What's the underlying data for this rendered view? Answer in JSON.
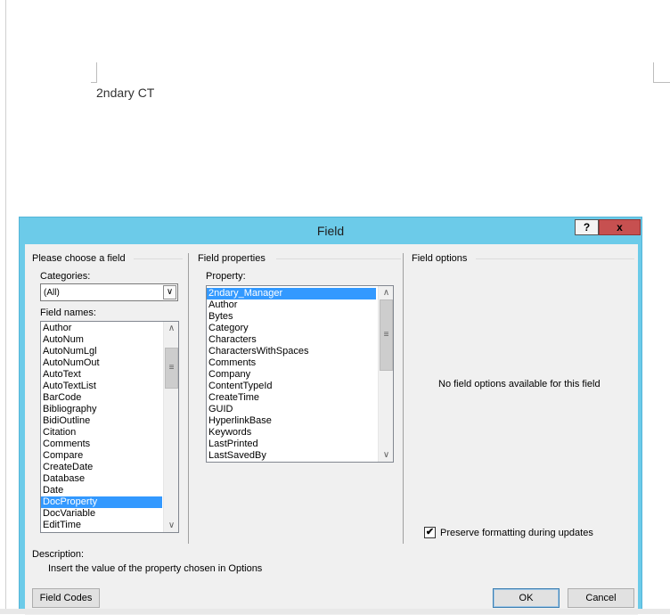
{
  "document": {
    "text": "2ndary CT"
  },
  "dialog": {
    "title": "Field",
    "help_label": "?",
    "close_label": "x",
    "left_group": {
      "heading": "Please choose a field",
      "categories_label": "Categories:",
      "categories_value": "(All)",
      "field_names_label": "Field names:",
      "field_names": [
        "Author",
        "AutoNum",
        "AutoNumLgl",
        "AutoNumOut",
        "AutoText",
        "AutoTextList",
        "BarCode",
        "Bibliography",
        "BidiOutline",
        "Citation",
        "Comments",
        "Compare",
        "CreateDate",
        "Database",
        "Date",
        "DocProperty",
        "DocVariable",
        "EditTime"
      ],
      "selected_field": "DocProperty"
    },
    "middle_group": {
      "heading": "Field properties",
      "property_label": "Property:",
      "properties": [
        "2ndary_Manager",
        "Author",
        "Bytes",
        "Category",
        "Characters",
        "CharactersWithSpaces",
        "Comments",
        "Company",
        "ContentTypeId",
        "CreateTime",
        "GUID",
        "HyperlinkBase",
        "Keywords",
        "LastPrinted",
        "LastSavedBy"
      ],
      "selected_property": "2ndary_Manager"
    },
    "right_group": {
      "heading": "Field options",
      "no_options_text": "No field options available for this field",
      "preserve_label": "Preserve formatting during updates",
      "preserve_checked": true
    },
    "description": {
      "label": "Description:",
      "text": "Insert the value of the property chosen in Options"
    },
    "buttons": {
      "field_codes": "Field Codes",
      "ok": "OK",
      "cancel": "Cancel"
    }
  }
}
